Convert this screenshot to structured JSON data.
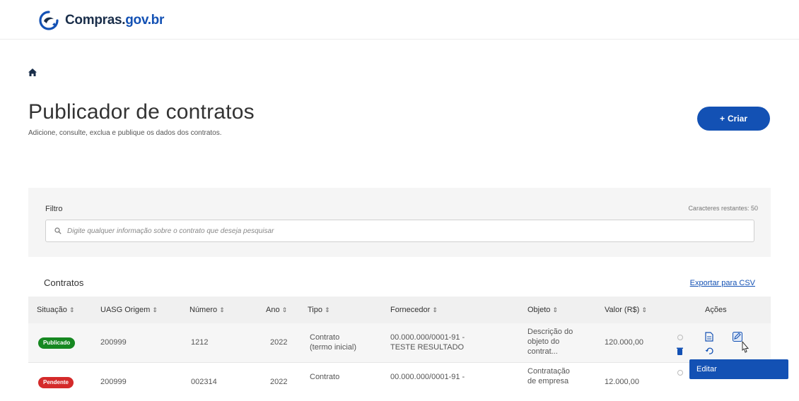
{
  "header": {
    "logo_main": "Compras.",
    "logo_suffix": "gov.br"
  },
  "page": {
    "title": "Publicador de contratos",
    "subtitle": "Adicione, consulte, exclua e publique os dados dos contratos.",
    "create_label": "Criar"
  },
  "filter": {
    "label": "Filtro",
    "chars_left": "Caracteres restantes: 50",
    "placeholder": "Digite qualquer informação sobre o contrato que deseja pesquisar"
  },
  "contracts": {
    "title": "Contratos",
    "export_label": "Exportar para CSV",
    "columns": [
      "Situação",
      "UASG Origem",
      "Número",
      "Ano",
      "Tipo",
      "Fornecedor",
      "Objeto",
      "Valor (R$)",
      "Ações"
    ],
    "rows": [
      {
        "status": "Publicado",
        "uasg": "200999",
        "numero": "1212",
        "ano": "2022",
        "tipo_1": "Contrato",
        "tipo_2": "(termo inicial)",
        "fornecedor_1": "00.000.000/0001-91 -",
        "fornecedor_2": "TESTE RESULTADO",
        "objeto_1": "Descrição do",
        "objeto_2": "objeto do",
        "objeto_3": "contrat...",
        "valor": "120.000,00"
      },
      {
        "status": "Pendente",
        "uasg": "200999",
        "numero": "002314",
        "ano": "2022",
        "tipo_1": "Contrato",
        "fornecedor_1": "00.000.000/0001-91 -",
        "objeto_1": "Contratação",
        "objeto_2": "de empresa",
        "valor": "12.000,00"
      }
    ]
  },
  "tooltip": {
    "label": "Editar"
  },
  "colors": {
    "primary": "#1351b4",
    "success": "#168821",
    "danger": "#d42a2a"
  }
}
